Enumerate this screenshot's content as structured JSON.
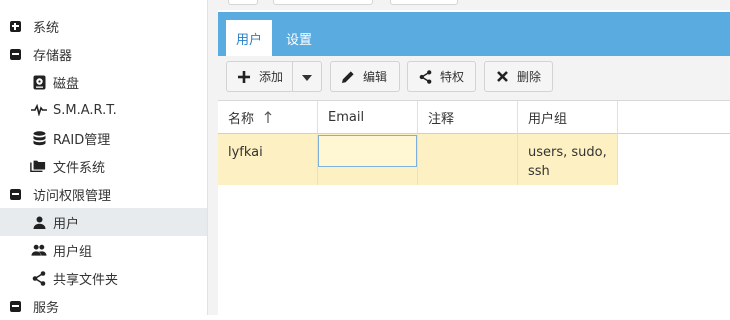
{
  "sidebar": {
    "items": [
      {
        "label": "系统",
        "icon": "plus-square-icon"
      },
      {
        "label": "存储器",
        "icon": "minus-square-icon"
      },
      {
        "label": "磁盘",
        "icon": "disk-icon"
      },
      {
        "label": "S.M.A.R.T.",
        "icon": "pulse-icon"
      },
      {
        "label": "RAID管理",
        "icon": "database-icon"
      },
      {
        "label": "文件系统",
        "icon": "folders-icon"
      },
      {
        "label": "访问权限管理",
        "icon": "minus-square-icon"
      },
      {
        "label": "用户",
        "icon": "user-icon",
        "active": true
      },
      {
        "label": "用户组",
        "icon": "users-icon"
      },
      {
        "label": "共享文件夹",
        "icon": "share-icon"
      },
      {
        "label": "服务",
        "icon": "minus-square-icon"
      }
    ]
  },
  "tabs": {
    "users": "用户",
    "settings": "设置"
  },
  "toolbar": {
    "add": "添加",
    "edit": "编辑",
    "privileges": "特权",
    "delete": "删除"
  },
  "table": {
    "headers": [
      "名称",
      "Email",
      "注释",
      "用户组"
    ],
    "sort_column": "名称",
    "sort_direction": "ascending",
    "rows": [
      {
        "name": "lyfkai",
        "email": "",
        "comment": "",
        "groups_line1": "users, sudo,",
        "groups_line2": "ssh"
      }
    ]
  },
  "colors": {
    "tabbar": "#5aace0",
    "active_tab_text": "#2a80c6",
    "row_highlight": "#fdf0c2",
    "sidebar_active": "#e8ebee"
  }
}
